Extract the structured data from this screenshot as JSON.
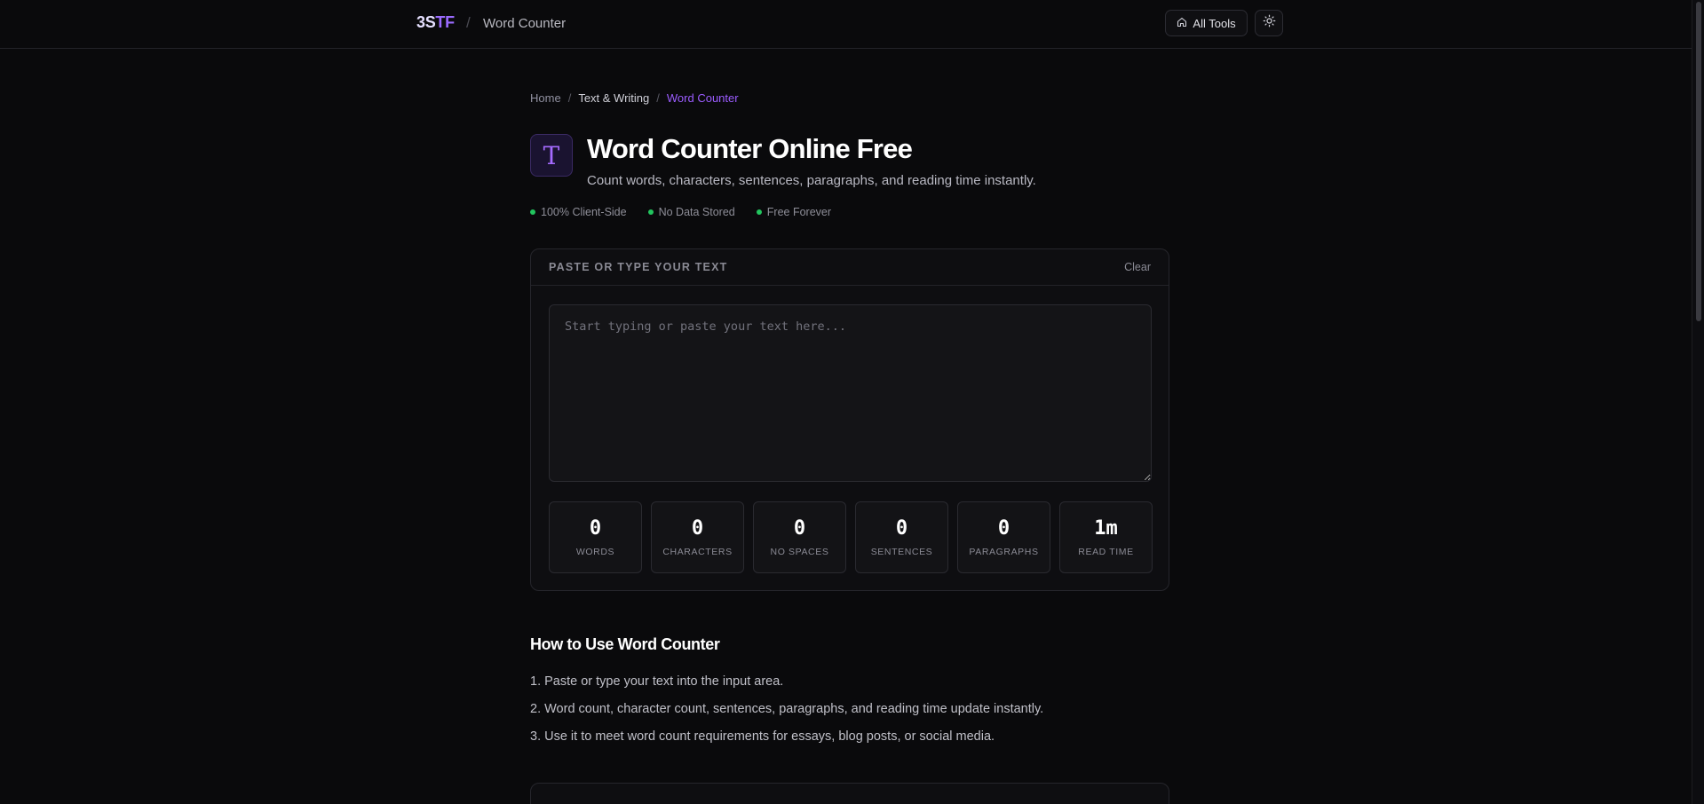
{
  "header": {
    "brand_part1": "3S",
    "brand_part2": "TF",
    "separator": "/",
    "title": "Word Counter",
    "all_tools_label": "All Tools",
    "all_tools_icon": "home-icon",
    "theme_icon": "sun-icon"
  },
  "breadcrumb": {
    "home": "Home",
    "sep": "/",
    "category": "Text & Writing",
    "current": "Word Counter"
  },
  "hero": {
    "icon_glyph": "T",
    "title": "Word Counter Online Free",
    "subtitle": "Count words, characters, sentences, paragraphs, and reading time instantly."
  },
  "badges": [
    "100% Client-Side",
    "No Data Stored",
    "Free Forever"
  ],
  "editor": {
    "label": "PASTE OR TYPE YOUR TEXT",
    "clear_label": "Clear",
    "value": "",
    "placeholder": "Start typing or paste your text here..."
  },
  "stats": [
    {
      "value": "0",
      "label": "WORDS"
    },
    {
      "value": "0",
      "label": "CHARACTERS"
    },
    {
      "value": "0",
      "label": "NO SPACES"
    },
    {
      "value": "0",
      "label": "SENTENCES"
    },
    {
      "value": "0",
      "label": "PARAGRAPHS"
    },
    {
      "value": "1m",
      "label": "READ TIME"
    }
  ],
  "howto": {
    "title": "How to Use Word Counter",
    "steps": [
      "1. Paste or type your text into the input area.",
      "2. Word count, character count, sentences, paragraphs, and reading time update instantly.",
      "3. Use it to meet word count requirements for essays, blog posts, or social media."
    ]
  },
  "colors": {
    "background": "#0a0a0c",
    "accent": "#9b5cff",
    "status_green": "#22c55e"
  }
}
